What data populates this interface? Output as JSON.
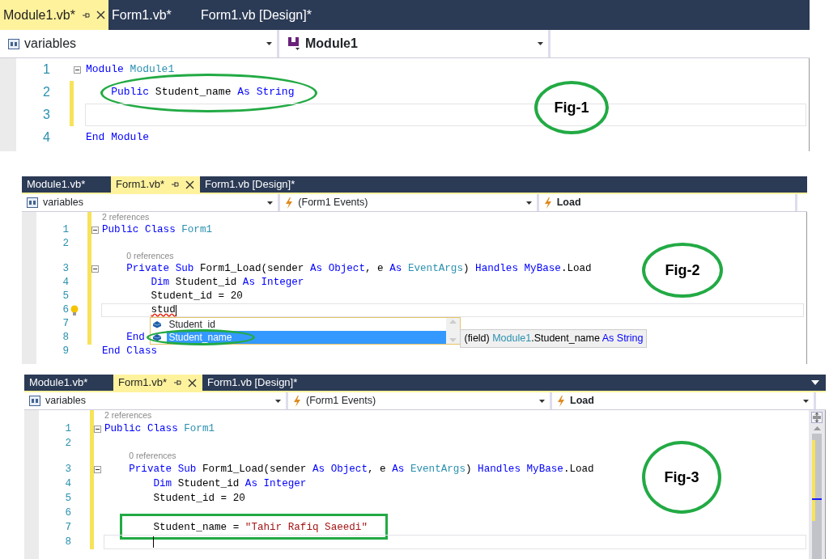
{
  "figures": [
    {
      "label": "Fig-1",
      "tab_overflow_menu": false,
      "scrollbar": false,
      "tabs": [
        {
          "label": "Module1.vb*",
          "selected": true
        },
        {
          "label": "Form1.vb*",
          "selected": false
        },
        {
          "label": "Form1.vb [Design]*",
          "selected": false
        }
      ],
      "nav": [
        {
          "kind": "file",
          "text": "variables",
          "bold": false,
          "caret": true
        },
        {
          "kind": "module",
          "text": "Module1",
          "bold": true,
          "caret": true
        }
      ],
      "lines": [
        {
          "kind": "code",
          "number": "1",
          "fold": true,
          "modified": false,
          "current": false,
          "caret": false,
          "tokens": [
            {
              "kind": "keyword",
              "text": "Module "
            },
            {
              "kind": "type",
              "text": "Module1"
            }
          ]
        },
        {
          "kind": "code",
          "number": "2",
          "fold": false,
          "modified": true,
          "current": false,
          "caret": false,
          "outline": {
            "kind": "ellipse"
          },
          "tokens": [
            {
              "kind": "keyword",
              "text": "    Public "
            },
            {
              "kind": "plain",
              "text": "Student_name "
            },
            {
              "kind": "keyword",
              "text": "As String"
            }
          ]
        },
        {
          "kind": "code",
          "number": "3",
          "fold": false,
          "modified": true,
          "current": true,
          "caret": false
        },
        {
          "kind": "code",
          "number": "4",
          "fold": false,
          "modified": false,
          "current": false,
          "caret": false,
          "tokens": [
            {
              "kind": "keyword",
              "text": "End Module"
            }
          ]
        }
      ]
    },
    {
      "label": "Fig-2",
      "tab_overflow_menu": false,
      "scrollbar": false,
      "tabs": [
        {
          "label": "Module1.vb*",
          "selected": false
        },
        {
          "label": "Form1.vb*",
          "selected": true
        },
        {
          "label": "Form1.vb [Design]*",
          "selected": false
        }
      ],
      "nav": [
        {
          "kind": "file",
          "text": "variables",
          "bold": false,
          "caret": true
        },
        {
          "kind": "event",
          "text": "(Form1 Events)",
          "bold": false,
          "caret": true
        },
        {
          "kind": "event",
          "text": "Load",
          "bold": true,
          "caret": false
        }
      ],
      "lines": [
        {
          "kind": "codelens",
          "text": "2 references",
          "modified": true
        },
        {
          "kind": "code",
          "number": "1",
          "fold": true,
          "modified": true,
          "current": false,
          "caret": false,
          "tokens": [
            {
              "kind": "keyword",
              "text": "Public Class "
            },
            {
              "kind": "type",
              "text": "Form1"
            }
          ]
        },
        {
          "kind": "code",
          "number": "2",
          "fold": false,
          "modified": true,
          "current": false,
          "caret": false
        },
        {
          "kind": "codelens",
          "text": "0 references",
          "modified": true
        },
        {
          "kind": "code",
          "number": "3",
          "fold": true,
          "modified": true,
          "current": false,
          "caret": false,
          "tokens": [
            {
              "kind": "keyword",
              "text": "    Private Sub "
            },
            {
              "kind": "plain",
              "text": "Form1_Load(sender "
            },
            {
              "kind": "keyword",
              "text": "As Object"
            },
            {
              "kind": "plain",
              "text": ", e "
            },
            {
              "kind": "keyword",
              "text": "As "
            },
            {
              "kind": "type",
              "text": "EventArgs"
            },
            {
              "kind": "plain",
              "text": ") "
            },
            {
              "kind": "keyword",
              "text": "Handles MyBase"
            },
            {
              "kind": "plain",
              "text": ".Load"
            }
          ]
        },
        {
          "kind": "code",
          "number": "4",
          "fold": false,
          "modified": true,
          "current": false,
          "caret": false,
          "tokens": [
            {
              "kind": "keyword",
              "text": "        Dim "
            },
            {
              "kind": "plain",
              "text": "Student_id "
            },
            {
              "kind": "keyword",
              "text": "As Integer"
            }
          ]
        },
        {
          "kind": "code",
          "number": "5",
          "fold": false,
          "modified": true,
          "current": false,
          "caret": false,
          "tokens": [
            {
              "kind": "plain",
              "text": "        Student_id = 20"
            }
          ]
        },
        {
          "kind": "code",
          "number": "6",
          "fold": false,
          "modified": true,
          "current": true,
          "caret": true,
          "lightbulb": true,
          "tokens": [
            {
              "kind": "error",
              "text": "stud"
            }
          ],
          "completion": {
            "items": [
              {
                "text": "Student_id",
                "selected": false,
                "circled": false
              },
              {
                "text": "Student_name",
                "selected": true,
                "circled": true
              }
            ],
            "tooltip": [
              {
                "kind": "plain",
                "text": "(field) "
              },
              {
                "kind": "type",
                "text": "Module1"
              },
              {
                "kind": "plain",
                "text": ".Student_name "
              },
              {
                "kind": "keyword",
                "text": "As String"
              }
            ]
          }
        },
        {
          "kind": "code",
          "number": "7",
          "fold": false,
          "modified": true,
          "current": false,
          "caret": false
        },
        {
          "kind": "code",
          "number": "8",
          "fold": false,
          "modified": true,
          "current": false,
          "caret": false,
          "tokens": [
            {
              "kind": "keyword",
              "text": "    End"
            }
          ]
        },
        {
          "kind": "code",
          "number": "9",
          "fold": false,
          "modified": false,
          "current": false,
          "caret": false,
          "tokens": [
            {
              "kind": "keyword",
              "text": "End Class"
            }
          ]
        }
      ]
    },
    {
      "label": "Fig-3",
      "tab_overflow_menu": true,
      "scrollbar": true,
      "tabs": [
        {
          "label": "Module1.vb*",
          "selected": false
        },
        {
          "label": "Form1.vb*",
          "selected": true
        },
        {
          "label": "Form1.vb [Design]*",
          "selected": false
        }
      ],
      "nav": [
        {
          "kind": "file",
          "text": "variables",
          "bold": false,
          "caret": true
        },
        {
          "kind": "event",
          "text": "(Form1 Events)",
          "bold": false,
          "caret": true
        },
        {
          "kind": "event",
          "text": "Load",
          "bold": true,
          "caret": true
        }
      ],
      "lines": [
        {
          "kind": "codelens",
          "text": "2 references",
          "modified": true
        },
        {
          "kind": "code",
          "number": "1",
          "fold": true,
          "modified": true,
          "current": false,
          "caret": false,
          "tokens": [
            {
              "kind": "keyword",
              "text": "Public Class "
            },
            {
              "kind": "type",
              "text": "Form1"
            }
          ]
        },
        {
          "kind": "code",
          "number": "2",
          "fold": false,
          "modified": true,
          "current": false,
          "caret": false
        },
        {
          "kind": "codelens",
          "text": "0 references",
          "modified": true
        },
        {
          "kind": "code",
          "number": "3",
          "fold": true,
          "modified": true,
          "current": false,
          "caret": false,
          "tokens": [
            {
              "kind": "keyword",
              "text": "    Private Sub "
            },
            {
              "kind": "plain",
              "text": "Form1_Load(sender "
            },
            {
              "kind": "keyword",
              "text": "As Object"
            },
            {
              "kind": "plain",
              "text": ", e "
            },
            {
              "kind": "keyword",
              "text": "As "
            },
            {
              "kind": "type",
              "text": "EventArgs"
            },
            {
              "kind": "plain",
              "text": ") "
            },
            {
              "kind": "keyword",
              "text": "Handles MyBase"
            },
            {
              "kind": "plain",
              "text": ".Load"
            }
          ]
        },
        {
          "kind": "code",
          "number": "4",
          "fold": false,
          "modified": true,
          "current": false,
          "caret": false,
          "tokens": [
            {
              "kind": "keyword",
              "text": "        Dim "
            },
            {
              "kind": "plain",
              "text": "Student_id "
            },
            {
              "kind": "keyword",
              "text": "As Integer"
            }
          ]
        },
        {
          "kind": "code",
          "number": "5",
          "fold": false,
          "modified": true,
          "current": false,
          "caret": false,
          "tokens": [
            {
              "kind": "plain",
              "text": "        Student_id = 20"
            }
          ]
        },
        {
          "kind": "code",
          "number": "6",
          "fold": false,
          "modified": true,
          "current": false,
          "caret": false
        },
        {
          "kind": "code",
          "number": "7",
          "fold": false,
          "modified": true,
          "current": false,
          "caret": false,
          "outline": {
            "kind": "rectangle"
          },
          "tokens": [
            {
              "kind": "plain",
              "text": "        Student_name = "
            },
            {
              "kind": "string",
              "text": "\"Tahir Rafiq Saeedi\""
            }
          ]
        },
        {
          "kind": "code",
          "number": "8",
          "fold": false,
          "modified": true,
          "current": true,
          "caret": true
        }
      ]
    }
  ]
}
